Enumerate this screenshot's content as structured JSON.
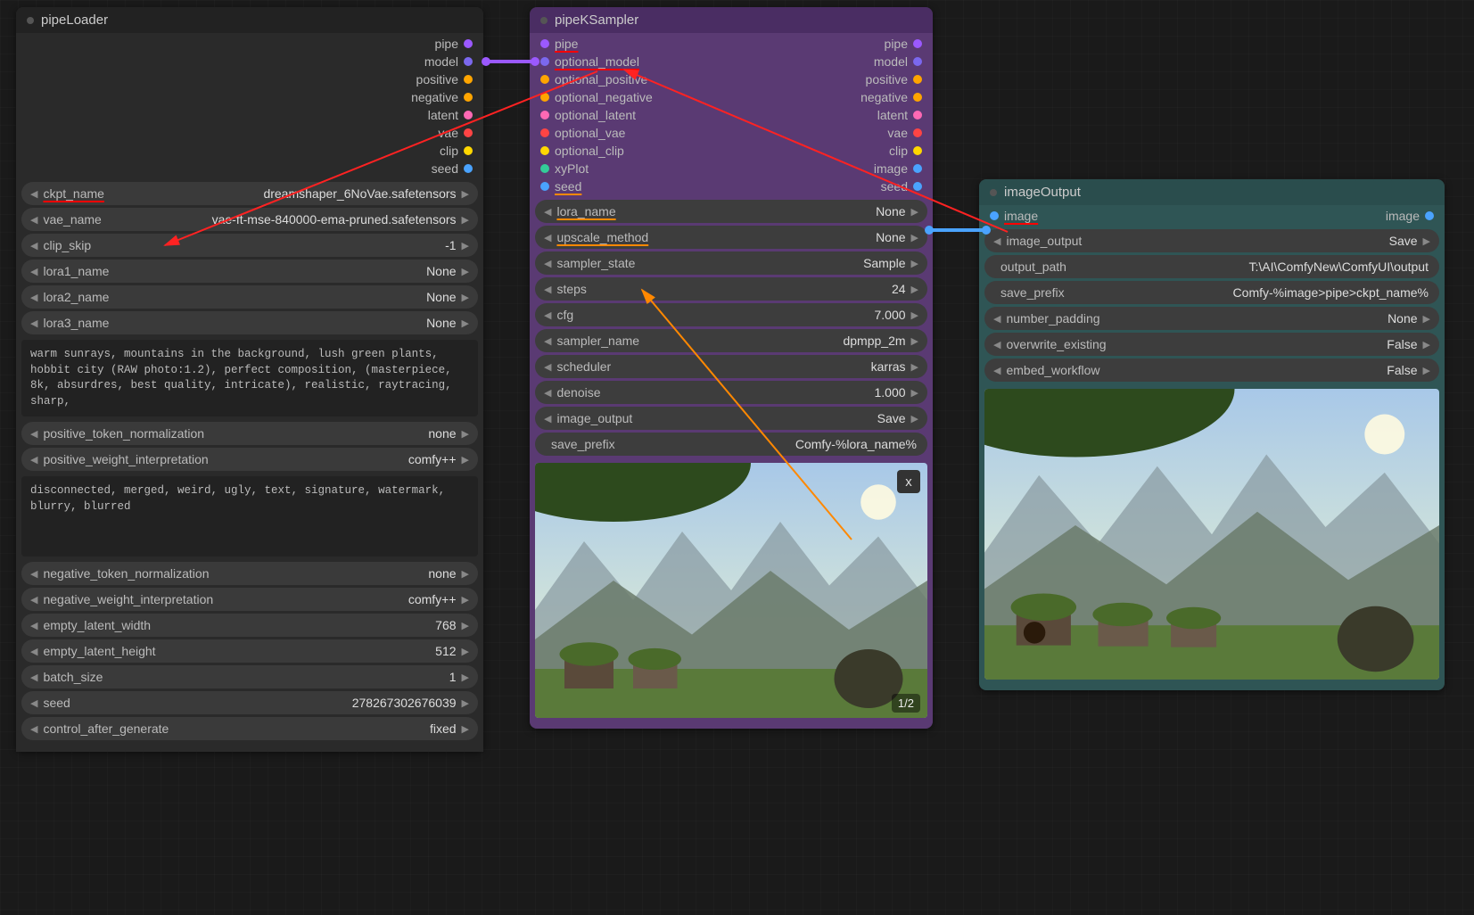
{
  "pipeLoader": {
    "title": "pipeLoader",
    "outputs": [
      "pipe",
      "model",
      "positive",
      "negative",
      "latent",
      "vae",
      "clip",
      "seed"
    ],
    "widgets": {
      "ckpt_name": {
        "label": "ckpt_name",
        "value": "dreamshaper_6NoVae.safetensors"
      },
      "vae_name": {
        "label": "vae_name",
        "value": "vae-ft-mse-840000-ema-pruned.safetensors"
      },
      "clip_skip": {
        "label": "clip_skip",
        "value": "-1"
      },
      "lora1_name": {
        "label": "lora1_name",
        "value": "None"
      },
      "lora2_name": {
        "label": "lora2_name",
        "value": "None"
      },
      "lora3_name": {
        "label": "lora3_name",
        "value": "None"
      },
      "positive_text": "warm sunrays, mountains in the background, lush green plants, hobbit city (RAW photo:1.2), perfect composition, (masterpiece, 8k, absurdres, best quality, intricate), realistic, raytracing, sharp,",
      "positive_token_normalization": {
        "label": "positive_token_normalization",
        "value": "none"
      },
      "positive_weight_interpretation": {
        "label": "positive_weight_interpretation",
        "value": "comfy++"
      },
      "negative_text": "disconnected, merged, weird, ugly, text, signature, watermark, blurry, blurred",
      "negative_token_normalization": {
        "label": "negative_token_normalization",
        "value": "none"
      },
      "negative_weight_interpretation": {
        "label": "negative_weight_interpretation",
        "value": "comfy++"
      },
      "empty_latent_width": {
        "label": "empty_latent_width",
        "value": "768"
      },
      "empty_latent_height": {
        "label": "empty_latent_height",
        "value": "512"
      },
      "batch_size": {
        "label": "batch_size",
        "value": "1"
      },
      "seed": {
        "label": "seed",
        "value": "278267302676039"
      },
      "control_after_generate": {
        "label": "control_after_generate",
        "value": "fixed"
      }
    }
  },
  "pipeKSampler": {
    "title": "pipeKSampler",
    "inputs": [
      "pipe",
      "optional_model",
      "optional_positive",
      "optional_negative",
      "optional_latent",
      "optional_vae",
      "optional_clip",
      "xyPlot",
      "seed"
    ],
    "outputs": [
      "pipe",
      "model",
      "positive",
      "negative",
      "latent",
      "vae",
      "clip",
      "image",
      "seed"
    ],
    "widgets": {
      "lora_name": {
        "label": "lora_name",
        "value": "None"
      },
      "upscale_method": {
        "label": "upscale_method",
        "value": "None"
      },
      "sampler_state": {
        "label": "sampler_state",
        "value": "Sample"
      },
      "steps": {
        "label": "steps",
        "value": "24"
      },
      "cfg": {
        "label": "cfg",
        "value": "7.000"
      },
      "sampler_name": {
        "label": "sampler_name",
        "value": "dpmpp_2m"
      },
      "scheduler": {
        "label": "scheduler",
        "value": "karras"
      },
      "denoise": {
        "label": "denoise",
        "value": "1.000"
      },
      "image_output": {
        "label": "image_output",
        "value": "Save"
      },
      "save_prefix": {
        "label": "save_prefix",
        "value": "Comfy-%lora_name%"
      }
    },
    "preview": {
      "close": "x",
      "counter": "1/2"
    }
  },
  "imageOutput": {
    "title": "imageOutput",
    "inputs": [
      "image"
    ],
    "outputs": [
      "image"
    ],
    "widgets": {
      "image_output": {
        "label": "image_output",
        "value": "Save"
      },
      "output_path": {
        "label": "output_path",
        "value": "T:\\AI\\ComfyNew\\ComfyUI\\output"
      },
      "save_prefix": {
        "label": "save_prefix",
        "value": "Comfy-%image>pipe>ckpt_name%"
      },
      "number_padding": {
        "label": "number_padding",
        "value": "None"
      },
      "overwrite_existing": {
        "label": "overwrite_existing",
        "value": "False"
      },
      "embed_workflow": {
        "label": "embed_workflow",
        "value": "False"
      }
    }
  },
  "port_colors": {
    "pipe": "#9b59ff",
    "model": "#7b68ee",
    "positive": "#ffa500",
    "negative": "#ffa500",
    "latent": "#ff69b4",
    "vae": "#ff4444",
    "clip": "#ffd700",
    "seed": "#4aa3ff",
    "image": "#4aa3ff",
    "optional_model": "#7b68ee",
    "optional_positive": "#ffa500",
    "optional_negative": "#ffa500",
    "optional_latent": "#ff69b4",
    "optional_vae": "#ff4444",
    "optional_clip": "#ffd700",
    "xyPlot": "#33cc99"
  }
}
